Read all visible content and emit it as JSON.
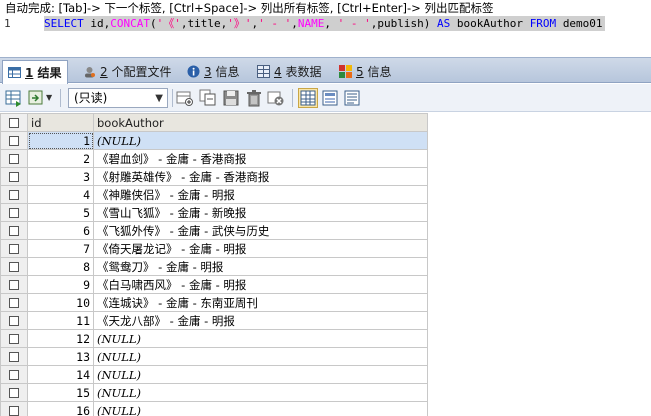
{
  "editor": {
    "hint": "自动完成: [Tab]-> 下一个标签, [Ctrl+Space]-> 列出所有标签, [Ctrl+Enter]-> 列出匹配标签",
    "line_number": "1",
    "sql_tokens": [
      {
        "t": "SELECT ",
        "k": "kw"
      },
      {
        "t": "id,",
        "k": "id"
      },
      {
        "t": "CONCAT",
        "k": "fn"
      },
      {
        "t": "(",
        "k": "op"
      },
      {
        "t": "'《'",
        "k": "str"
      },
      {
        "t": ",title,",
        "k": "id"
      },
      {
        "t": "'》'",
        "k": "str"
      },
      {
        "t": ",",
        "k": "op"
      },
      {
        "t": "' - '",
        "k": "str"
      },
      {
        "t": ",",
        "k": "op"
      },
      {
        "t": "NAME",
        "k": "fn"
      },
      {
        "t": ", ",
        "k": "op"
      },
      {
        "t": "' - '",
        "k": "str"
      },
      {
        "t": ",publish) ",
        "k": "id"
      },
      {
        "t": "AS ",
        "k": "kw"
      },
      {
        "t": "bookAuthor ",
        "k": "id"
      },
      {
        "t": "FROM ",
        "k": "kw"
      },
      {
        "t": "demo01",
        "k": "id"
      }
    ]
  },
  "tabs": [
    {
      "num": "1",
      "label": "结果",
      "icon": "table-result-icon",
      "active": true
    },
    {
      "num": "2",
      "label": "个配置文件",
      "icon": "profile-icon",
      "active": false
    },
    {
      "num": "3",
      "label": "信息",
      "icon": "info-icon",
      "active": false
    },
    {
      "num": "4",
      "label": "表数据",
      "icon": "table-data-icon",
      "active": false
    },
    {
      "num": "5",
      "label": "信息",
      "icon": "info-color-icon",
      "active": false
    }
  ],
  "toolbar": {
    "mode_select": "(只读)"
  },
  "grid": {
    "columns": [
      "id",
      "bookAuthor"
    ],
    "rows": [
      {
        "id": "1",
        "bookAuthor": "(NULL)",
        "null": true
      },
      {
        "id": "2",
        "bookAuthor": "《碧血剑》 - 金庸 - 香港商报",
        "null": false
      },
      {
        "id": "3",
        "bookAuthor": "《射雕英雄传》 - 金庸 - 香港商报",
        "null": false
      },
      {
        "id": "4",
        "bookAuthor": "《神雕侠侣》 - 金庸 - 明报",
        "null": false
      },
      {
        "id": "5",
        "bookAuthor": "《雪山飞狐》 - 金庸 - 新晚报",
        "null": false
      },
      {
        "id": "6",
        "bookAuthor": "《飞狐外传》 - 金庸 - 武侠与历史",
        "null": false
      },
      {
        "id": "7",
        "bookAuthor": "《倚天屠龙记》 - 金庸 - 明报",
        "null": false
      },
      {
        "id": "8",
        "bookAuthor": "《鸳鸯刀》 - 金庸 - 明报",
        "null": false
      },
      {
        "id": "9",
        "bookAuthor": "《白马啸西风》 - 金庸 - 明报",
        "null": false
      },
      {
        "id": "10",
        "bookAuthor": "《连城诀》 - 金庸 - 东南亚周刊",
        "null": false
      },
      {
        "id": "11",
        "bookAuthor": "《天龙八部》 - 金庸 - 明报",
        "null": false
      },
      {
        "id": "12",
        "bookAuthor": "(NULL)",
        "null": true
      },
      {
        "id": "13",
        "bookAuthor": "(NULL)",
        "null": true
      },
      {
        "id": "14",
        "bookAuthor": "(NULL)",
        "null": true
      },
      {
        "id": "15",
        "bookAuthor": "(NULL)",
        "null": true
      },
      {
        "id": "16",
        "bookAuthor": "(NULL)",
        "null": true
      }
    ]
  }
}
